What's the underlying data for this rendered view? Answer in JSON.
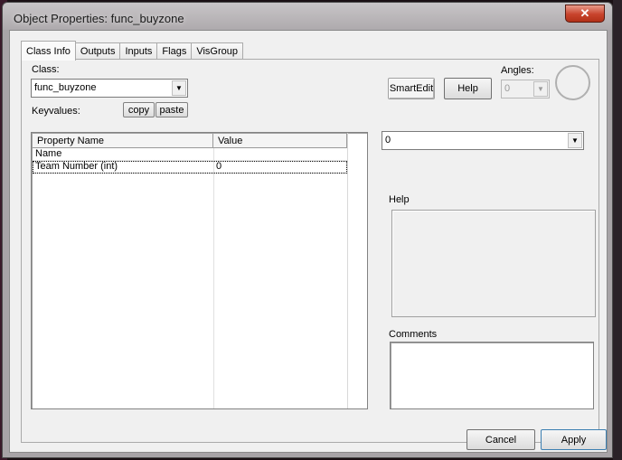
{
  "window": {
    "title": "Object Properties: func_buyzone",
    "close_label": "✕"
  },
  "tabs": [
    {
      "label": "Class Info",
      "active": true
    },
    {
      "label": "Outputs"
    },
    {
      "label": "Inputs"
    },
    {
      "label": "Flags"
    },
    {
      "label": "VisGroup"
    }
  ],
  "class_section": {
    "class_label": "Class:",
    "class_value": "func_buyzone",
    "keyvalues_label": "Keyvalues:",
    "copy_label": "copy",
    "paste_label": "paste"
  },
  "toolbar": {
    "smartedit_label": "SmartEdit",
    "help_label": "Help",
    "angles_label": "Angles:",
    "angles_value": "0"
  },
  "property_table": {
    "columns": [
      "Property Name",
      "Value"
    ],
    "rows": [
      {
        "name": "Name",
        "value": ""
      },
      {
        "name": "Team Number (int)",
        "value": "0"
      }
    ]
  },
  "value_editor": {
    "value": "0"
  },
  "help_panel": {
    "label": "Help"
  },
  "comments_panel": {
    "label": "Comments"
  },
  "footer": {
    "cancel_label": "Cancel",
    "apply_label": "Apply"
  }
}
